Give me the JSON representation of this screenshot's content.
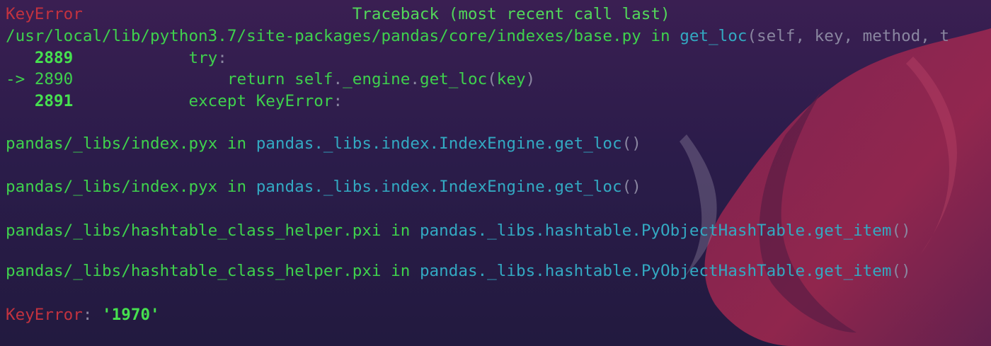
{
  "colors": {
    "background": "#2b1c4a",
    "error_red": "#c3323f",
    "green": "#3fd14d",
    "cyan": "#33a9c2",
    "gray": "#8a86a0",
    "accent_blob": "#a0284f"
  },
  "traceback": {
    "error_name": "KeyError",
    "header": "Traceback (most recent call last)",
    "frame1": {
      "path": "/usr/local/lib/python3.7/site-packages/pandas/core/indexes/base.py",
      "in_kw": "in",
      "func": "get_loc",
      "args": "(self, key, method, t",
      "lines": [
        {
          "marker": "",
          "num": "2889",
          "indent": "            ",
          "code": [
            {
              "t": "try",
              "c": "green"
            },
            {
              "t": ":",
              "c": "gray"
            }
          ]
        },
        {
          "marker": "-> ",
          "num": "2890",
          "indent": "                ",
          "code": [
            {
              "t": "return ",
              "c": "green"
            },
            {
              "t": "self",
              "c": "green"
            },
            {
              "t": ".",
              "c": "gray"
            },
            {
              "t": "_engine",
              "c": "green"
            },
            {
              "t": ".",
              "c": "gray"
            },
            {
              "t": "get_loc",
              "c": "green"
            },
            {
              "t": "(",
              "c": "gray"
            },
            {
              "t": "key",
              "c": "green"
            },
            {
              "t": ")",
              "c": "gray"
            }
          ]
        },
        {
          "marker": "",
          "num": "2891",
          "indent": "            ",
          "code": [
            {
              "t": "except ",
              "c": "green"
            },
            {
              "t": "KeyError",
              "c": "green"
            },
            {
              "t": ":",
              "c": "gray"
            }
          ]
        }
      ]
    },
    "frames": [
      {
        "file": "pandas/_libs/index.pyx",
        "in_kw": "in",
        "func": "pandas._libs.index.IndexEngine.get_loc",
        "call": "()"
      },
      {
        "file": "pandas/_libs/index.pyx",
        "in_kw": "in",
        "func": "pandas._libs.index.IndexEngine.get_loc",
        "call": "()"
      },
      {
        "file": "pandas/_libs/hashtable_class_helper.pxi",
        "in_kw": "in",
        "func": "pandas._libs.hashtable.PyObjectHashTable.get_item",
        "call": "()"
      },
      {
        "file": "pandas/_libs/hashtable_class_helper.pxi",
        "in_kw": "in",
        "func": "pandas._libs.hashtable.PyObjectHashTable.get_item",
        "call": "()"
      }
    ],
    "final_error": {
      "name": "KeyError",
      "sep": ": ",
      "value": "'1970'"
    }
  }
}
